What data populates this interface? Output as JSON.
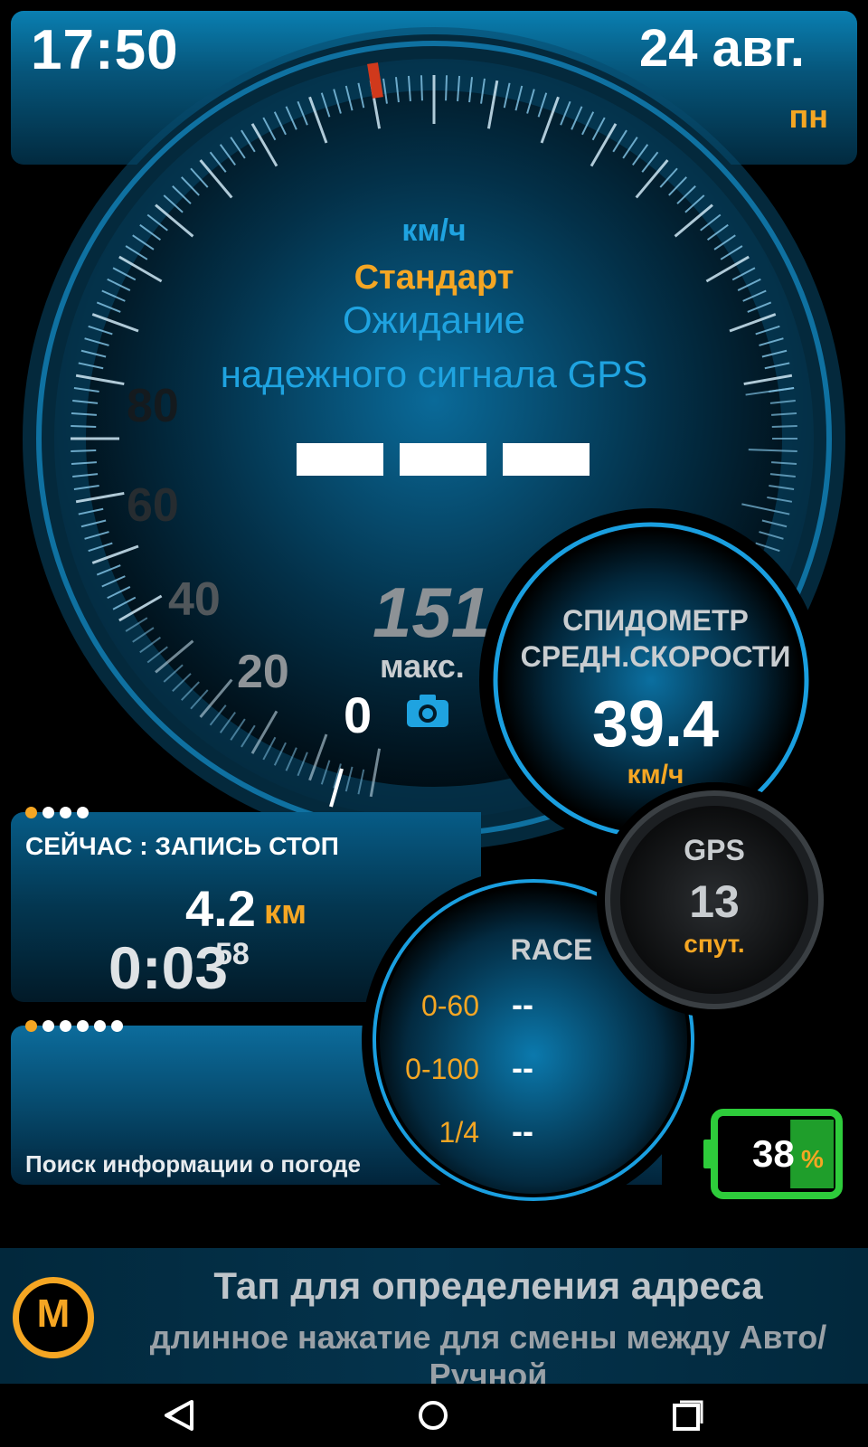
{
  "header": {
    "time": "17:50",
    "date": "24 авг.",
    "weekday": "пн"
  },
  "speedometer": {
    "unit": "км/ч",
    "mode": "Стандарт",
    "status_line1": "Ожидание",
    "status_line2": "надежного сигнала GPS",
    "scale_labels": [
      "80",
      "60",
      "40",
      "20"
    ],
    "max_value": "151",
    "max_label": "макс.",
    "current_speed": "0",
    "camera_icon": "camera-icon"
  },
  "trip": {
    "status": "СЕЙЧАС : ЗАПИСЬ СТОП",
    "distance": "4.2",
    "distance_unit": "км",
    "duration": "0:03",
    "duration_seconds": "58"
  },
  "average_speed": {
    "title_line1": "СПИДОМЕТР",
    "title_line2": "СРЕДН.СКОРОСТИ",
    "value": "39.4",
    "unit": "км/ч"
  },
  "race": {
    "title": "RACE",
    "rows": [
      {
        "label": "0-60",
        "value": "--"
      },
      {
        "label": "0-100",
        "value": "--"
      },
      {
        "label": "1/4",
        "value": "--"
      }
    ]
  },
  "gps": {
    "title": "GPS",
    "satellites": "13",
    "unit": "спут."
  },
  "battery": {
    "level": "38",
    "unit": "%",
    "fill_fraction": 0.38
  },
  "weather": {
    "status": "Поиск информации о погоде"
  },
  "address": {
    "mode_button": "M",
    "line1": "Тап для определения адреса",
    "line2": "длинное нажатие для смены между Авто/Ручной"
  },
  "colors": {
    "accent": "#1fa3e0",
    "highlight": "#f5a623",
    "battery": "#2ecc3b"
  }
}
